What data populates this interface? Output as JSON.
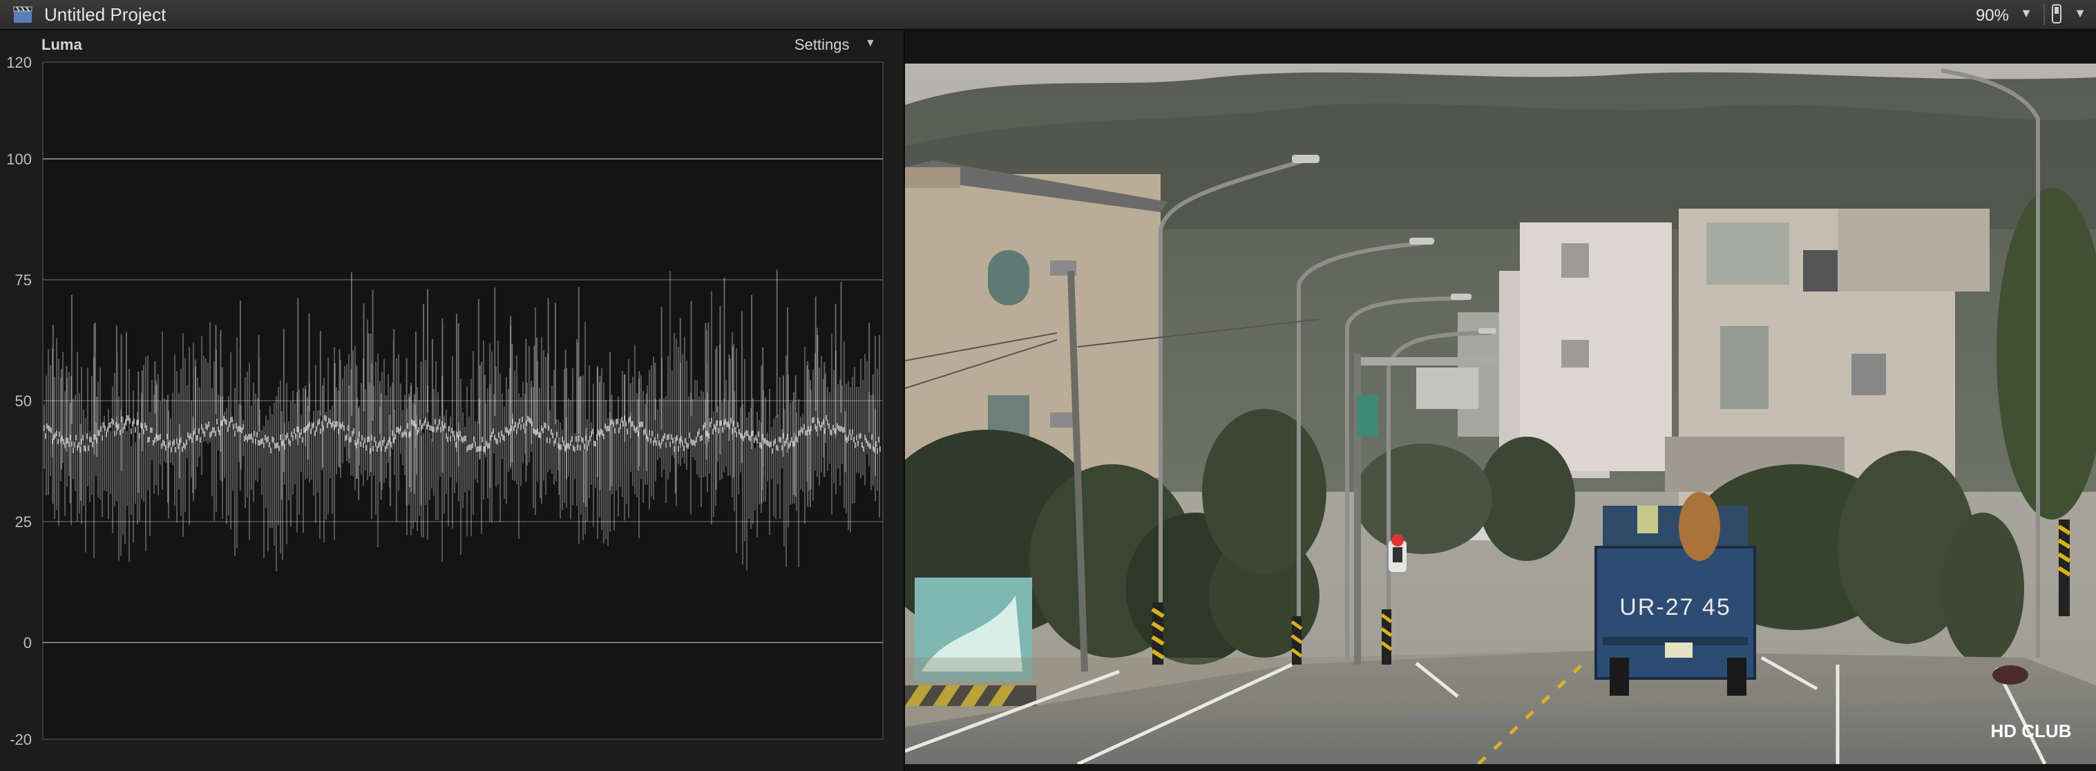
{
  "window": {
    "title": "Untitled Project",
    "zoom": "90%",
    "icons": [
      "clapperboard-icon",
      "chevron-down-icon",
      "view-switch-icon",
      "chevron-down-icon"
    ]
  },
  "scope": {
    "title": "Luma",
    "settings_label": "Settings",
    "axis_ticks": [
      "120",
      "100",
      "75",
      "50",
      "25",
      "0",
      "-20"
    ],
    "grid_color": "#7a7a7a",
    "trace_color": "#ffffff"
  },
  "viewer": {
    "plate_text": "UR-27 45",
    "watermark": "HD CLUB"
  }
}
